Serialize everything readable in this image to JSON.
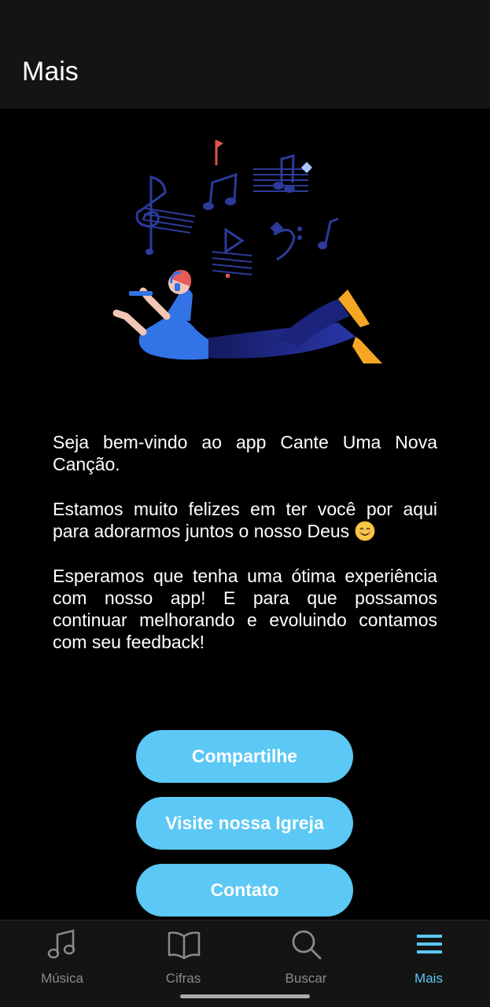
{
  "colors": {
    "background": "#000000",
    "bar_background": "#141414",
    "accent": "#5bc8f5",
    "nav_inactive": "#8a8a8a",
    "text": "#ffffff"
  },
  "header": {
    "title": "Mais"
  },
  "illustration": {
    "icon": "person-listening-music-illustration"
  },
  "content": {
    "paragraph_1": "Seja bem-vindo ao app Cante Uma Nova Canção.",
    "paragraph_2": "Estamos muito felizes em ter você por aqui para adorarmos juntos o nosso Deus",
    "paragraph_2_emoji": "smiling-face-emoji",
    "paragraph_3": "Esperamos que tenha uma ótima experiência com nosso app! E para que possamos continuar melhorando e evoluindo contamos com seu feedback!"
  },
  "buttons": {
    "share": "Compartilhe",
    "church": "Visite nossa Igreja",
    "contact": "Contato"
  },
  "bottom_nav": {
    "items": [
      {
        "label": "Música",
        "icon": "music-note-icon",
        "active": false
      },
      {
        "label": "Cifras",
        "icon": "book-icon",
        "active": false
      },
      {
        "label": "Buscar",
        "icon": "search-icon",
        "active": false
      },
      {
        "label": "Mais",
        "icon": "menu-icon",
        "active": true
      }
    ]
  }
}
